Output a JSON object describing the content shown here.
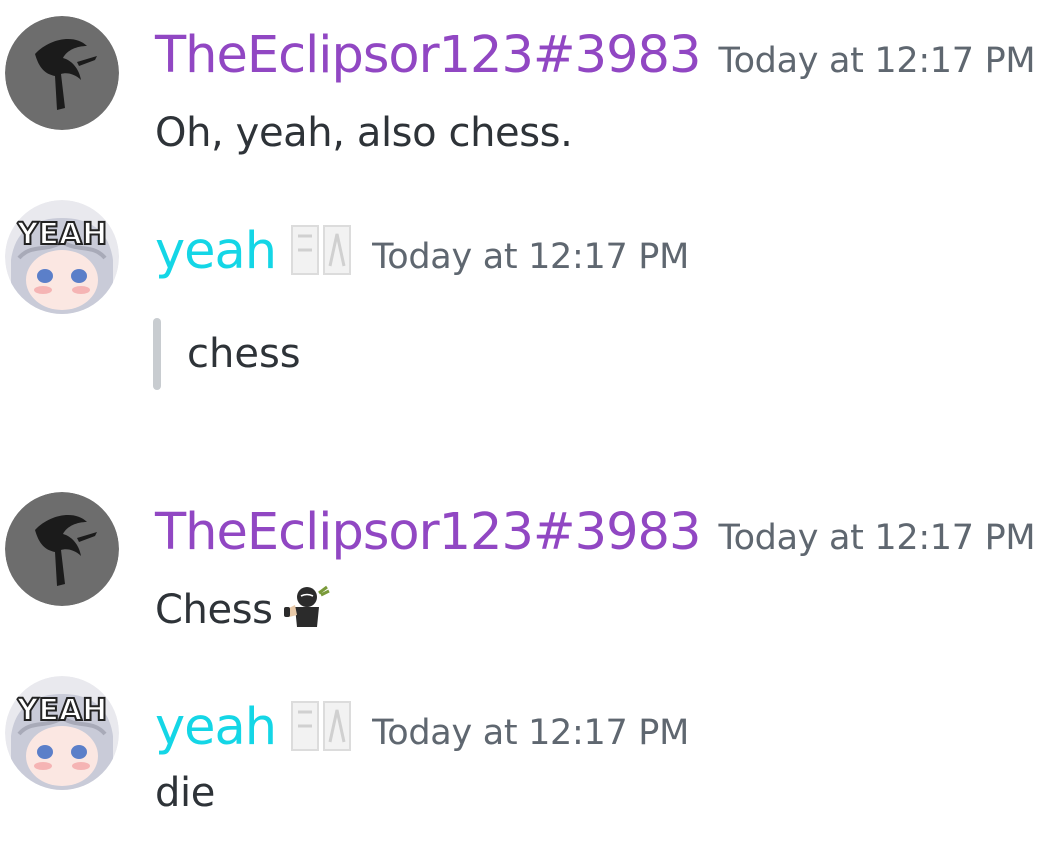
{
  "messages": [
    {
      "author": "TheEclipsor123#3983",
      "timestamp": "Today at 12:17 PM",
      "text": "Oh, yeah, also chess."
    },
    {
      "author": "yeah",
      "avatar_text": "YEAH",
      "timestamp": "Today at 12:17 PM",
      "quote": "chess"
    },
    {
      "author": "TheEclipsor123#3983",
      "timestamp": "Today at 12:17 PM",
      "text": "Chess"
    },
    {
      "author": "yeah",
      "avatar_text": "YEAH",
      "timestamp": "Today at 12:17 PM",
      "text": "die"
    }
  ],
  "icons": {
    "eclipsor_avatar": "reaper-silhouette-icon",
    "yeah_avatar": "anime-girl-yeah-icon",
    "badge": "role-badge-icon",
    "emoji": "ninja-thumbs-up-icon"
  },
  "colors": {
    "eclipsor_name": "#9147c3",
    "yeah_name": "#14d6e6",
    "timestamp": "#5f6770",
    "text": "#2e3338",
    "quote_bar": "#c8ccd0"
  }
}
